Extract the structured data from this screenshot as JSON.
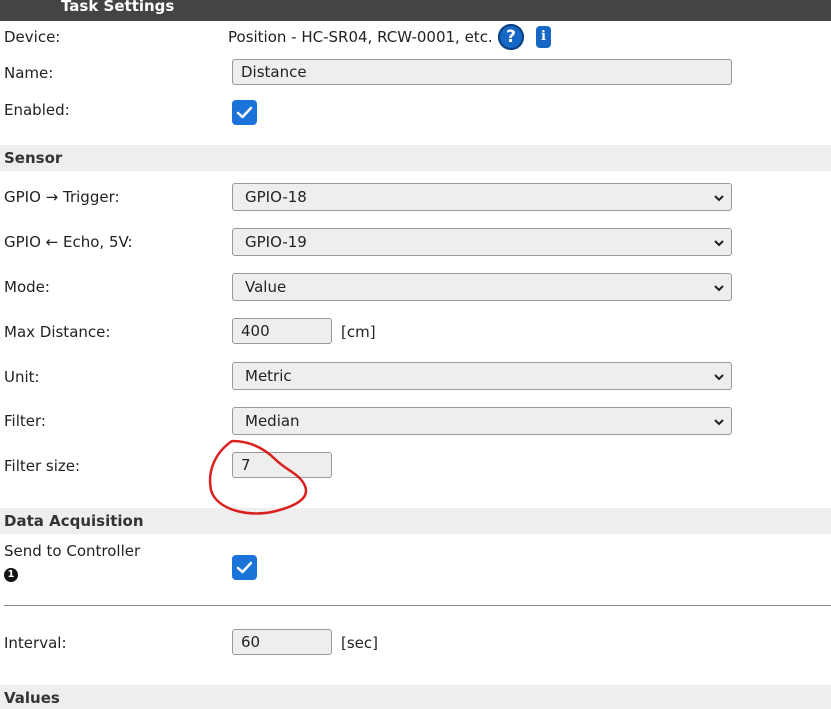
{
  "header": {
    "title": "Task Settings"
  },
  "device": {
    "label": "Device:",
    "value": "Position - HC-SR04, RCW-0001, etc.",
    "help_icon": "?",
    "info_icon": "i"
  },
  "name": {
    "label": "Name:",
    "value": "Distance"
  },
  "enabled": {
    "label": "Enabled:",
    "checked": true
  },
  "sensor": {
    "section_title": "Sensor",
    "trigger": {
      "label": "GPIO → Trigger:",
      "value": "GPIO-18"
    },
    "echo": {
      "label": "GPIO ← Echo, 5V:",
      "value": "GPIO-19"
    },
    "mode": {
      "label": "Mode:",
      "value": "Value"
    },
    "max_distance": {
      "label": "Max Distance:",
      "value": "400",
      "unit": "[cm]"
    },
    "unit": {
      "label": "Unit:",
      "value": "Metric"
    },
    "filter": {
      "label": "Filter:",
      "value": "Median"
    },
    "filter_size": {
      "label": "Filter size:",
      "value": "7"
    }
  },
  "acquisition": {
    "section_title": "Data Acquisition",
    "send_to_controller": {
      "label": "Send to Controller",
      "controller_number": "1",
      "checked": true
    },
    "interval": {
      "label": "Interval:",
      "value": "60",
      "unit": "[sec]"
    }
  },
  "values": {
    "section_title": "Values"
  },
  "colors": {
    "header_bg": "#444444",
    "section_bg": "#eeeeee",
    "accent": "#1a73d9",
    "annotation": "#d9201e"
  },
  "icons": {
    "help": "question-circle-icon",
    "info": "info-icon",
    "dropdown": "chevron-down-icon",
    "check": "check-icon"
  }
}
